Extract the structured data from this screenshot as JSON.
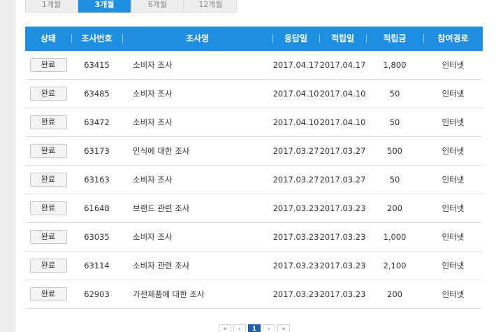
{
  "tabs": [
    {
      "label": "1개월"
    },
    {
      "label": "3개월"
    },
    {
      "label": "6개월"
    },
    {
      "label": "12개월"
    }
  ],
  "table": {
    "headers": [
      "상태",
      "조사번호",
      "조사명",
      "응답일",
      "적립일",
      "적립금",
      "참여경로"
    ],
    "rows": [
      {
        "status": "완료",
        "id": "63415",
        "name": "소비자 조사",
        "response_date": "2017.04.17",
        "reward_date": "2017.04.17",
        "points": "1,800",
        "channel": "인터넷"
      },
      {
        "status": "완료",
        "id": "63485",
        "name": "소비자 조사",
        "response_date": "2017.04.10",
        "reward_date": "2017.04.10",
        "points": "50",
        "channel": "인터넷"
      },
      {
        "status": "완료",
        "id": "63472",
        "name": "소비자 조사",
        "response_date": "2017.04.10",
        "reward_date": "2017.04.10",
        "points": "50",
        "channel": "인터넷"
      },
      {
        "status": "완료",
        "id": "63173",
        "name": "인식에 대한 조사",
        "response_date": "2017.03.27",
        "reward_date": "2017.03.27",
        "points": "500",
        "channel": "인터넷"
      },
      {
        "status": "완료",
        "id": "63163",
        "name": "소비자 조사",
        "response_date": "2017.03.27",
        "reward_date": "2017.03.27",
        "points": "50",
        "channel": "인터넷"
      },
      {
        "status": "완료",
        "id": "61648",
        "name": "브랜드 관련 조사",
        "response_date": "2017.03.23",
        "reward_date": "2017.03.23",
        "points": "200",
        "channel": "인터넷"
      },
      {
        "status": "완료",
        "id": "63035",
        "name": "소비자 조사",
        "response_date": "2017.03.23",
        "reward_date": "2017.03.23",
        "points": "1,000",
        "channel": "인터넷"
      },
      {
        "status": "완료",
        "id": "63114",
        "name": "소비자 관련 조사",
        "response_date": "2017.03.23",
        "reward_date": "2017.03.23",
        "points": "2,100",
        "channel": "인터넷"
      },
      {
        "status": "완료",
        "id": "62903",
        "name": "가전제품에 대한 조사",
        "response_date": "2017.03.23",
        "reward_date": "2017.03.23",
        "points": "200",
        "channel": "인터넷"
      }
    ]
  },
  "pagination": {
    "first_icon": "double-chevron-left-icon",
    "prev_icon": "chevron-left-icon",
    "current_page": "1",
    "next_icon": "chevron-right-icon",
    "last_icon": "double-chevron-right-icon"
  },
  "colors": {
    "accent": "#1e8fe0",
    "active_page": "#1e5fa8"
  }
}
